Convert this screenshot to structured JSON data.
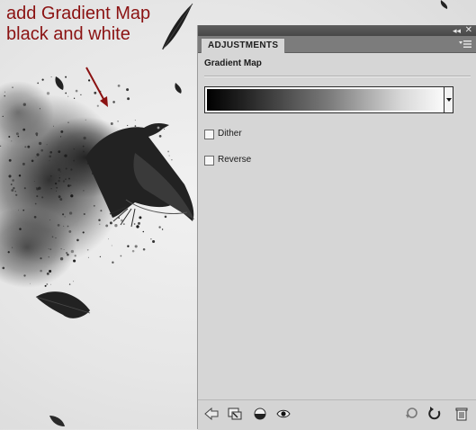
{
  "annotation": {
    "line1": "add Gradient Map",
    "line2": "black and white",
    "color": "#8b1212"
  },
  "panel": {
    "tab_label": "ADJUSTMENTS",
    "title": "Gradient Map",
    "gradient": {
      "from": "#000000",
      "to": "#ffffff",
      "value": "black-to-white"
    },
    "options": {
      "dither": {
        "label": "Dither",
        "checked": false
      },
      "reverse": {
        "label": "Reverse",
        "checked": false
      }
    },
    "topbar_icons": [
      "collapse-icon",
      "close-icon"
    ],
    "bottom_icons": [
      "back-arrow-icon",
      "clip-to-layer-icon",
      "layer-visibility-toggle-icon",
      "eye-icon",
      "view-previous-state-icon",
      "reset-icon",
      "trash-icon"
    ]
  },
  "background": {
    "subject": "crow-disintegrating-into-feathers",
    "colors": [
      "#e6e6e6",
      "#1a1a1a"
    ]
  }
}
